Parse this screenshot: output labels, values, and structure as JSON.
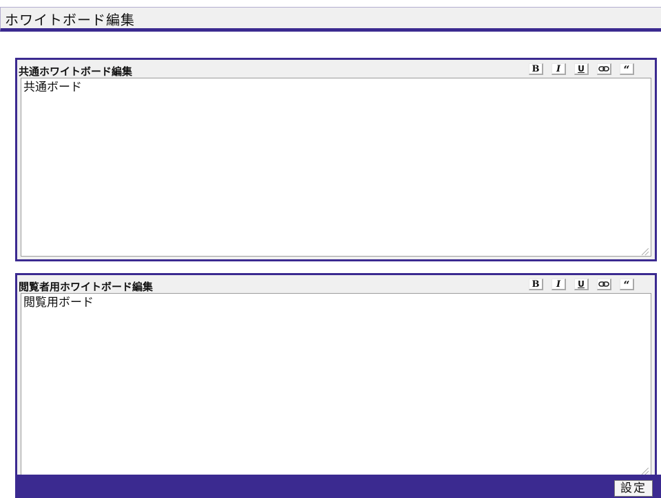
{
  "page": {
    "title": "ホワイトボード編集"
  },
  "panels": [
    {
      "label": "共通ホワイトボード編集",
      "content": "共通ボード"
    },
    {
      "label": "閲覧者用ホワイトボード編集",
      "content": "閲覧用ボード"
    }
  ],
  "toolbar": {
    "bold_label": "B",
    "italic_label": "I",
    "underline_label": "U",
    "link_label": "⊖",
    "quote_label": "“"
  },
  "footer": {
    "submit_label": "設定"
  },
  "colors": {
    "accent": "#3b2a90",
    "panel_bg": "#f0f0f0",
    "editor_bg": "#ffffff"
  },
  "icons": {
    "bold": "bold-icon",
    "italic": "italic-icon",
    "underline": "underline-icon",
    "link": "link-icon",
    "quote": "quote-icon"
  }
}
